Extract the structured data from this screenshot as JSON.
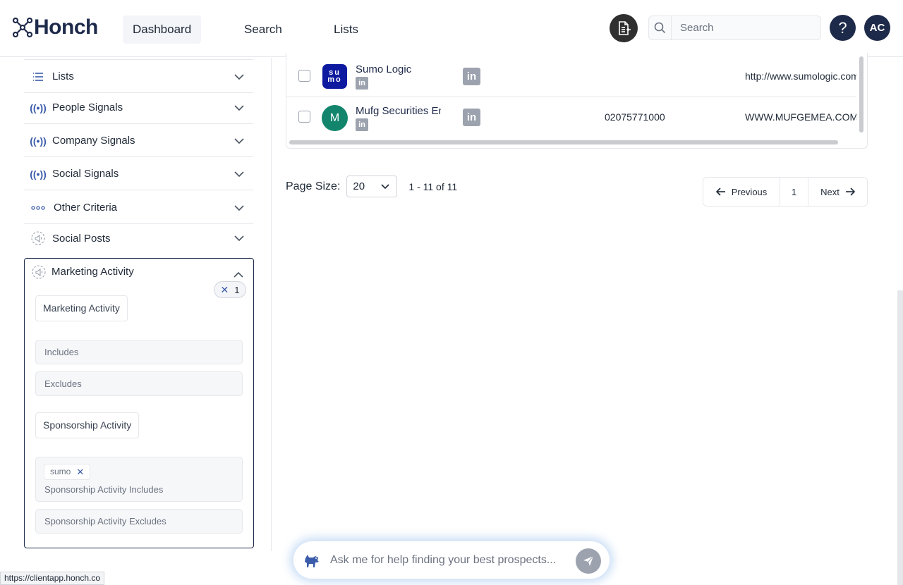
{
  "header": {
    "brand": "Honch",
    "nav": {
      "dashboard": "Dashboard",
      "search": "Search",
      "lists": "Lists"
    },
    "search_placeholder": "Search",
    "help_label": "?",
    "avatar_initials": "AC"
  },
  "sidebar": {
    "filters": [
      {
        "label": "Lists",
        "icon": "list-icon"
      },
      {
        "label": "People Signals",
        "icon": "signal-icon"
      },
      {
        "label": "Company Signals",
        "icon": "signal-icon"
      },
      {
        "label": "Social Signals",
        "icon": "signal-icon"
      },
      {
        "label": "Other Criteria",
        "icon": "dots-icon"
      },
      {
        "label": "Social Posts",
        "icon": "megaphone-icon"
      }
    ],
    "marketing": {
      "title": "Marketing Activity",
      "count": "1",
      "section1_label": "Marketing Activity",
      "includes_placeholder": "Includes",
      "excludes_placeholder": "Excludes",
      "section2_label": "Sponsorship Activity",
      "sponsor_tag": "sumo",
      "sponsor_includes_placeholder": "Sponsorship Activity Includes",
      "sponsor_excludes_placeholder": "Sponsorship Activity Excludes"
    }
  },
  "table": {
    "rows": [
      {
        "logo_text": "su mo",
        "name": "Sumo Logic",
        "phone": "",
        "website": "http://www.sumologic.com"
      },
      {
        "logo_text": "M",
        "name": "Mufg Securities Emea",
        "phone": "02075771000",
        "website": "WWW.MUFGEMEA.COM"
      }
    ]
  },
  "pagination": {
    "page_size_label": "Page Size:",
    "page_size": "20",
    "range": "1 - 11 of 11",
    "previous": "Previous",
    "current_page": "1",
    "next": "Next"
  },
  "chat": {
    "placeholder": "Ask me for help finding your best prospects..."
  },
  "status_url": "https://clientapp.honch.co",
  "colors": {
    "brand_navy": "#1e2a4a",
    "accent_blue": "#3b5bab",
    "avatar_green": "#13856d"
  }
}
